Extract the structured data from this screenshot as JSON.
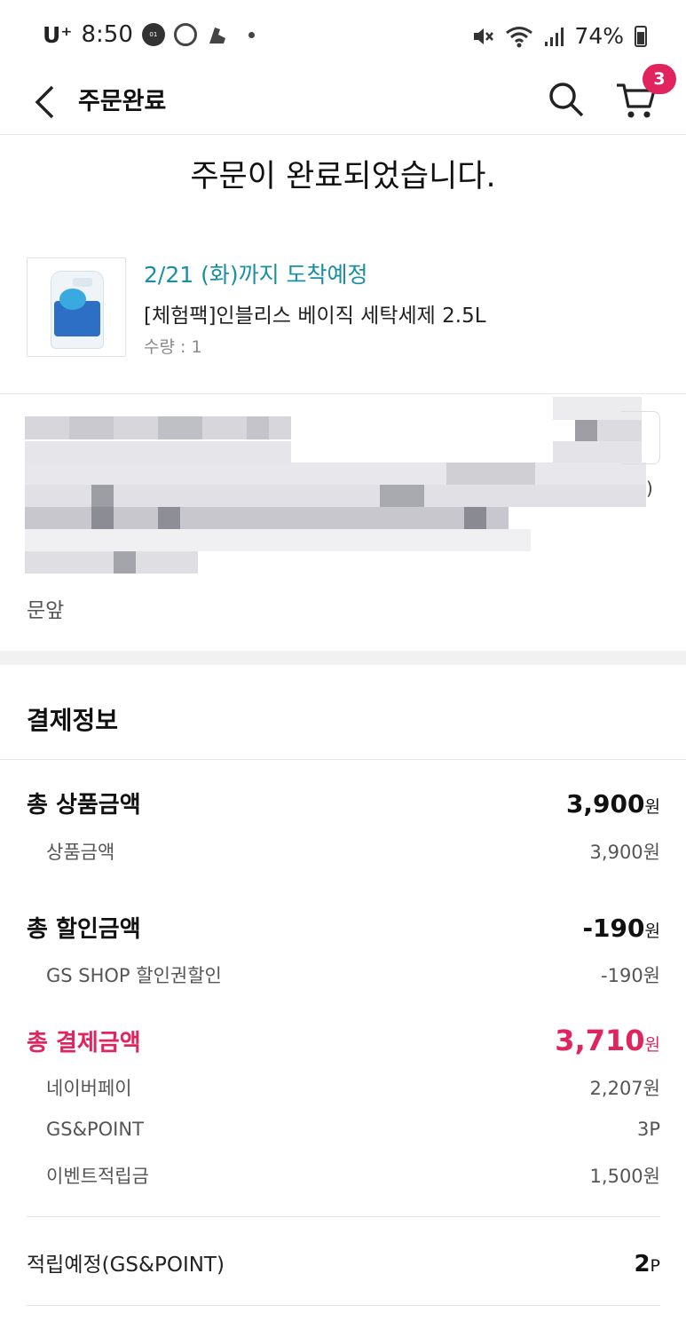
{
  "status_bar": {
    "carrier": "U⁺",
    "time": "8:50",
    "app_icon_label": "01 LOCK",
    "battery": "74%"
  },
  "header": {
    "title": "주문완료",
    "cart_count": "3"
  },
  "order_done_message": "주문이 완료되었습니다.",
  "product": {
    "eta": "2/21 (화)까지 도착예정",
    "name": "[체험팩]인블리스 베이직 세탁세제 2.5L",
    "quantity": "수량 : 1"
  },
  "delivery": {
    "addr_suffix": ")",
    "request_note": "문앞"
  },
  "payment": {
    "title": "결제정보",
    "total_product_label": "총 상품금액",
    "total_product_value": "3,900",
    "product_amount_label": "상품금액",
    "product_amount_value": "3,900원",
    "total_discount_label": "총 할인금액",
    "total_discount_value": "-190",
    "coupon_label": "GS SHOP 할인권할인",
    "coupon_value": "-190원",
    "total_pay_label": "총 결제금액",
    "total_pay_value": "3,710",
    "naverpay_label": "네이버페이",
    "naverpay_value": "2,207원",
    "gspoint_label": "GS&POINT",
    "gspoint_value": "3P",
    "event_label": "이벤트적립금",
    "event_value": "1,500원",
    "accrual_label": "적립예정(GS&POINT)",
    "accrual_value": "2",
    "accrual_unit": "P",
    "won_unit": "원"
  },
  "colors": {
    "accent_pink": "#e0245e",
    "eta_teal": "#1a8fa3"
  }
}
